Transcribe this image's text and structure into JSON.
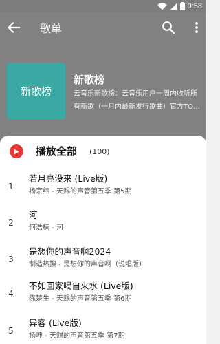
{
  "status_bar": {
    "time": "9:58",
    "icons": [
      "wifi-icon",
      "signal-icon",
      "battery-icon"
    ]
  },
  "app_bar": {
    "title": "歌单",
    "icons": [
      "back-arrow-icon",
      "search-icon",
      "more-vert-icon"
    ]
  },
  "playlist": {
    "cover_text": "新歌榜",
    "name": "新歌榜",
    "description": "云音乐新歌榜：云音乐用户一周内收听所有新歌（一月内最新发行歌曲）官方TOP排行榜，每天更新。"
  },
  "play_all": {
    "label": "播放全部",
    "count": "(100)"
  },
  "songs": [
    {
      "index": "1",
      "title": "若月亮没来 (Live版)",
      "subtitle": "杨宗纬 - 天赐的声音第五季 第5期"
    },
    {
      "index": "2",
      "title": "河",
      "subtitle": "何浩楠 - 河"
    },
    {
      "index": "3",
      "title": "是想你的声音啊2024",
      "subtitle": "制造热搜 - 是想你的声音啊（说唱版）"
    },
    {
      "index": "4",
      "title": "不如回家喝自来水 (Live版)",
      "subtitle": "陈楚生 - 天赐的声音第五季 第6期"
    },
    {
      "index": "5",
      "title": "异客 (Live版)",
      "subtitle": "杨坤 - 天赐的声音第五季 第7期"
    }
  ],
  "colors": {
    "header_bg": "#818181",
    "status_bg": "#7d7d7d",
    "cover_bg": "#3aa9a4",
    "play_icon": "#e53935"
  }
}
